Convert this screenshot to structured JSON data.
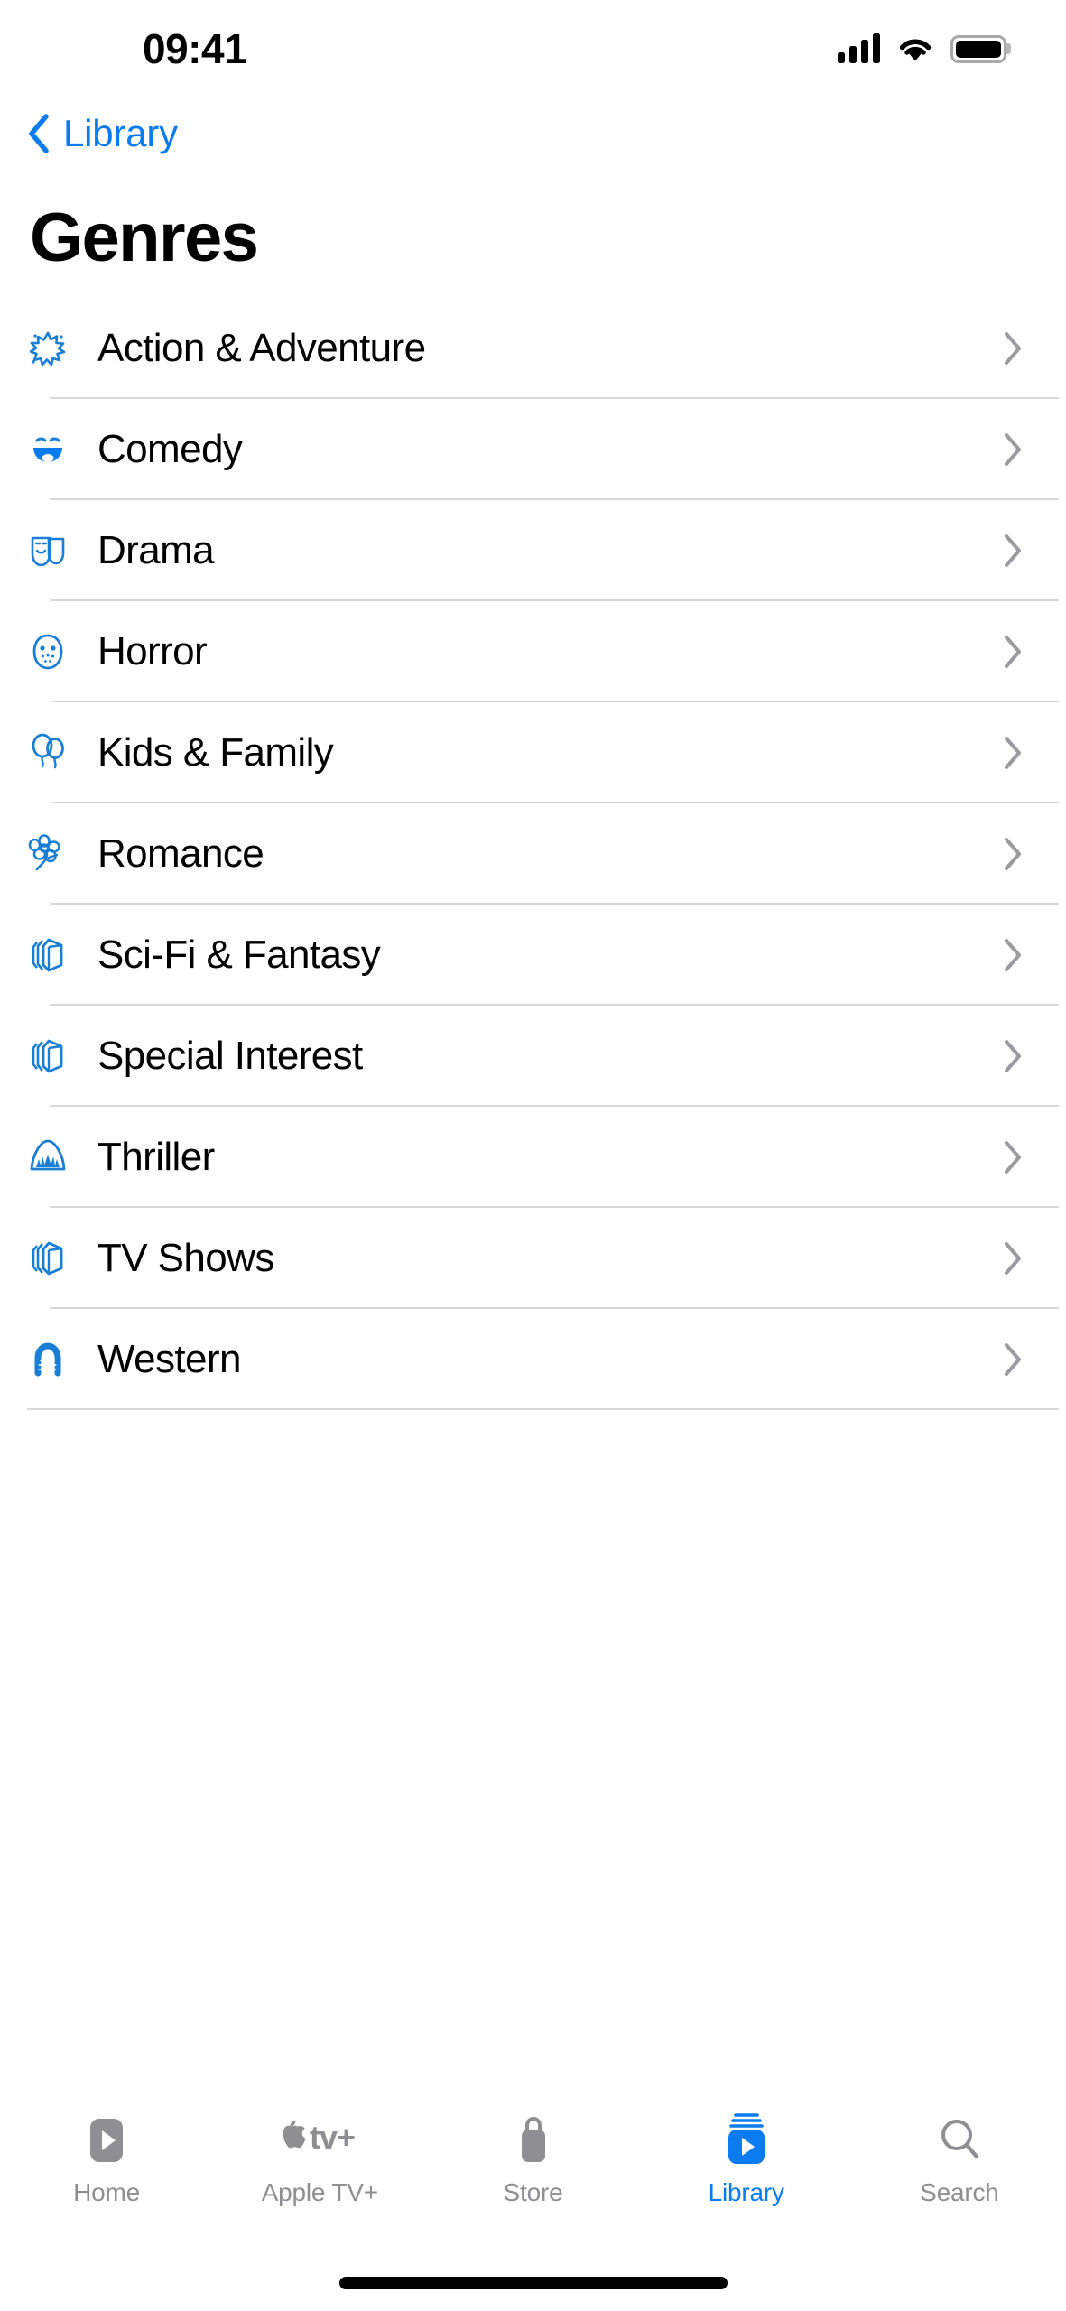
{
  "status_bar": {
    "time": "09:41",
    "cellular_icon": "cellular-bars-icon",
    "wifi_icon": "wifi-icon",
    "battery_icon": "battery-full-icon"
  },
  "nav": {
    "back_icon": "chevron-left-icon",
    "back_label": "Library"
  },
  "page": {
    "title": "Genres"
  },
  "colors": {
    "accent": "#0a7cf0",
    "icon_blue": "#1a7fd4",
    "label": "#000000",
    "separator": "#d8d8da",
    "inactive_tab": "#8e8e93",
    "chevron": "#9a9a9f"
  },
  "genres": [
    {
      "label": "Action & Adventure",
      "icon": "starburst-icon",
      "disclosure_icon": "chevron-right-icon"
    },
    {
      "label": "Comedy",
      "icon": "smiley-face-icon",
      "disclosure_icon": "chevron-right-icon"
    },
    {
      "label": "Drama",
      "icon": "theater-masks-icon",
      "disclosure_icon": "chevron-right-icon"
    },
    {
      "label": "Horror",
      "icon": "hockey-mask-icon",
      "disclosure_icon": "chevron-right-icon"
    },
    {
      "label": "Kids & Family",
      "icon": "balloons-icon",
      "disclosure_icon": "chevron-right-icon"
    },
    {
      "label": "Romance",
      "icon": "flower-icon",
      "disclosure_icon": "chevron-right-icon"
    },
    {
      "label": "Sci-Fi & Fantasy",
      "icon": "film-stack-icon",
      "disclosure_icon": "chevron-right-icon"
    },
    {
      "label": "Special Interest",
      "icon": "film-stack-icon",
      "disclosure_icon": "chevron-right-icon"
    },
    {
      "label": "Thriller",
      "icon": "shark-icon",
      "disclosure_icon": "chevron-right-icon"
    },
    {
      "label": "TV Shows",
      "icon": "film-stack-icon",
      "disclosure_icon": "chevron-right-icon"
    },
    {
      "label": "Western",
      "icon": "horseshoe-icon",
      "disclosure_icon": "chevron-right-icon"
    }
  ],
  "tab_bar": {
    "tabs": [
      {
        "label": "Home",
        "icon": "play-box-icon",
        "active": false
      },
      {
        "label": "Apple TV+",
        "icon": "apple-tv-plus-icon",
        "active": false
      },
      {
        "label": "Store",
        "icon": "shopping-bag-icon",
        "active": false
      },
      {
        "label": "Library",
        "icon": "library-stack-icon",
        "active": true
      },
      {
        "label": "Search",
        "icon": "magnifier-icon",
        "active": false
      }
    ]
  }
}
